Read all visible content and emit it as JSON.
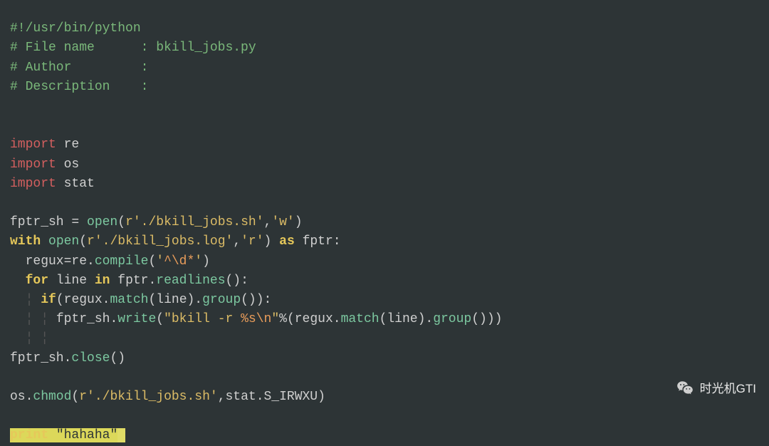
{
  "code": {
    "l1_shebang": "#!/usr/bin/python",
    "l2_filecomment_a": "# File name      : ",
    "l2_filecomment_b": "bkill_jobs.py",
    "l3_author": "# Author         :",
    "l4_desc": "# Description    :",
    "import_kw": "import",
    "mod_re": "re",
    "mod_os": "os",
    "mod_stat": "stat",
    "open_fn": "open",
    "open_sh_pre": "fptr_sh = ",
    "open_sh_arg1_r": "r",
    "open_sh_arg1_str": "'./bkill_jobs.sh'",
    "open_sh_arg2": "'w'",
    "with_kw": "with",
    "open_log_arg1_r": "r",
    "open_log_arg1_str": "'./bkill_jobs.log'",
    "open_log_arg2": "'r'",
    "as_kw": "as",
    "fptr_id": "fptr",
    "regux_assign": "  regux=re.",
    "compile_fn": "compile",
    "regex_open": "'",
    "regex_body": "^\\d*",
    "regex_close": "'",
    "for_kw": "for",
    "line_id": "line",
    "in_kw": "in",
    "readlines_expr_a": " fptr.",
    "readlines_fn": "readlines",
    "if_kw": "if",
    "if_cond_a": "(regux.",
    "match_fn": "match",
    "if_cond_b": "(line).",
    "group_fn": "group",
    "if_cond_c": "()):",
    "write_pre": "fptr_sh.",
    "write_fn": "write",
    "write_str_a": "\"bkill -r ",
    "write_str_fmt": "%s",
    "write_str_esc": "\\n",
    "write_str_b": "\"",
    "write_after": "%(regux.",
    "write_after_b": "(line).",
    "write_after_c": "()))",
    "close_line_a": "fptr_sh.",
    "close_fn": "close",
    "chmod_line_a": "os.",
    "chmod_fn": "chmod",
    "chmod_arg1_r": "r",
    "chmod_arg1_str": "'./bkill_jobs.sh'",
    "chmod_arg2": ",stat.S_IRWXU)",
    "print_kw": "print",
    "print_sp": " ",
    "print_str": "\"hahaha\"",
    "guide": "¦",
    "guide2": "¦ ¦"
  },
  "watermark": {
    "text": "时光机GTI"
  }
}
